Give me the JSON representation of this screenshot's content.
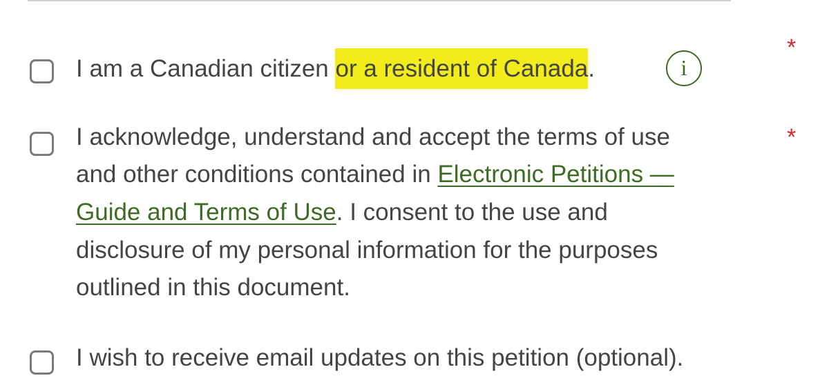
{
  "form": {
    "citizen": {
      "label_start": "I am a Canadian citizen ",
      "label_highlight": "or a resident of Canada",
      "label_end": ".",
      "info_glyph": "i",
      "required_mark": "*"
    },
    "terms": {
      "line1": "I acknowledge, understand and accept the terms of use",
      "line2_text": "and other conditions contained in ",
      "link_part1": "Electronic Petitions —",
      "link_part2": "Guide and Terms of Use",
      "line3_text": ". I consent to the use and",
      "line4": "disclosure of my personal information for the purposes",
      "line5": "outlined in this document.",
      "required_mark": "*"
    },
    "email_updates": {
      "label": "I wish to receive email updates on this petition (optional)."
    }
  },
  "colors": {
    "highlight": "#f2ec1a",
    "link": "#3d6b22",
    "required": "#d8262c",
    "text": "#444444"
  }
}
